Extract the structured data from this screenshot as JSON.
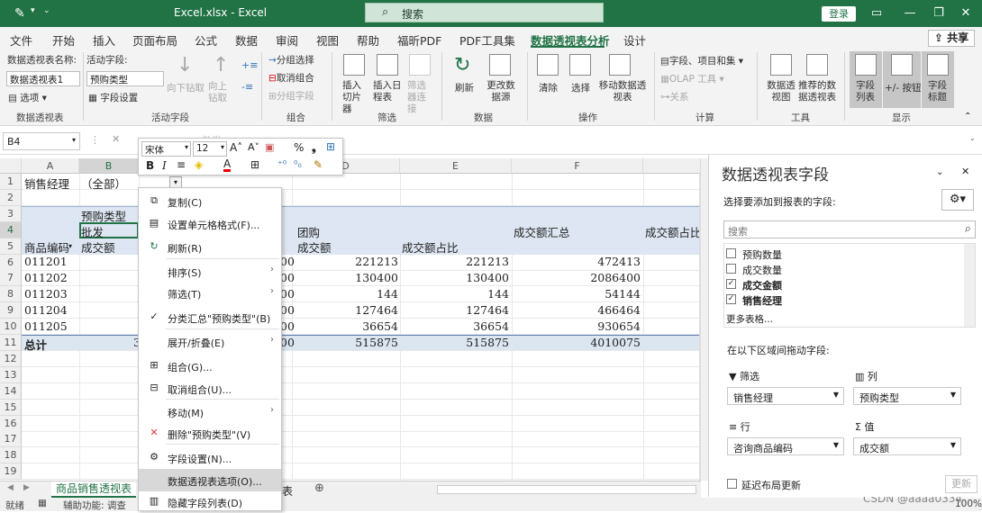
{
  "titlebar": {
    "title": "Excel.xlsx  -  Excel",
    "search": "搜索",
    "login": "登录",
    "min": "—",
    "restore": "❐",
    "close": "✕"
  },
  "tabs": [
    "文件",
    "开始",
    "插入",
    "页面布局",
    "公式",
    "数据",
    "审阅",
    "视图",
    "帮助",
    "福昕PDF",
    "PDF工具集",
    "数据透视表分析",
    "设计"
  ],
  "share": "共享",
  "ribbon": {
    "pt_name_label": "数据透视表名称:",
    "pt_name_value": "数据透视表1",
    "options": "选项",
    "group_pt": "数据透视表",
    "active_field_label": "活动字段:",
    "active_field_value": "预购类型",
    "field_settings": "字段设置",
    "drill_down": "向下钻取",
    "drill_up": "向上钻取",
    "group_active": "活动字段",
    "group_select": "分组选择",
    "ungroup": "取消组合",
    "group_field": "分组字段",
    "group_group": "组合",
    "insert_slicer": "插入切片器",
    "insert_timeline": "插入日程表",
    "filter_conn": "筛选器连接",
    "group_filter": "筛选",
    "refresh": "刷新",
    "change_source": "更改数据源",
    "group_data": "数据",
    "clear": "清除",
    "select": "选择",
    "move_pt": "移动数据透视表",
    "group_action": "操作",
    "fields_items": "字段、项目和集",
    "olap": "OLAP 工具",
    "relations": "关系",
    "group_calc": "计算",
    "pivot_chart": "数据透视图",
    "recommend": "推荐的数据透视表",
    "group_tools": "工具",
    "field_list": "字段列表",
    "pm_buttons": "+/- 按钮",
    "field_headers": "字段标题",
    "group_show": "显示"
  },
  "formula": {
    "namebox": "B4",
    "cancel": "✕",
    "value": "批发"
  },
  "grid": {
    "cols": [
      "A",
      "B",
      "C",
      "D",
      "E",
      "F"
    ],
    "rows": [
      "1",
      "2",
      "3",
      "4",
      "5",
      "6",
      "7",
      "8",
      "9",
      "10",
      "11",
      "12",
      "13",
      "14",
      "15",
      "16",
      "17",
      "18",
      "19"
    ],
    "a1": "销售经理",
    "b1": "（全部）",
    "b3": "预购类型",
    "b4": "批发",
    "a5": "商品编码",
    "b5": "成交额",
    "d4": "团购",
    "d5": "成交额",
    "e5": "成交额占比",
    "f4": "成交额汇总",
    "g4": "成交额占比",
    "rows_data": [
      {
        "code": "011201",
        "d": "00",
        "e1": "221213",
        "e2": "221213",
        "f": "472413"
      },
      {
        "code": "011202",
        "d": "00",
        "e1": "130400",
        "e2": "130400",
        "f": "2086400"
      },
      {
        "code": "011203",
        "d": "00",
        "e1": "144",
        "e2": "144",
        "f": "54144"
      },
      {
        "code": "011204",
        "d": "00",
        "e1": "127464",
        "e2": "127464",
        "f": "466464"
      },
      {
        "code": "011205",
        "d": "00",
        "e1": "36654",
        "e2": "36654",
        "f": "930654"
      }
    ],
    "total": {
      "label": "总计",
      "b": "3",
      "d": "00",
      "e1": "515875",
      "e2": "515875",
      "f": "4010075"
    }
  },
  "sheettabs": {
    "active": "商品销售透视表",
    "other": "表"
  },
  "status": {
    "ready": "就绪",
    "accessibility": "辅助功能: 调查",
    "zoom": "100%",
    "watermark": "CSDN @aaaa0334"
  },
  "mini_toolbar": {
    "font": "宋体",
    "size": "12"
  },
  "context_menu": [
    {
      "label": "复制(C)",
      "icon": "copy-icon",
      "glyph": "⧉"
    },
    {
      "label": "设置单元格格式(F)...",
      "icon": "format-cells-icon",
      "glyph": "▤"
    },
    {
      "label": "刷新(R)",
      "icon": "refresh-icon",
      "glyph": "↻"
    },
    {
      "label": "排序(S)",
      "icon": "",
      "glyph": ""
    },
    {
      "label": "筛选(T)",
      "icon": "",
      "glyph": ""
    },
    {
      "label": "分类汇总\"预购类型\"(B)",
      "icon": "check-icon",
      "glyph": "✓"
    },
    {
      "label": "展开/折叠(E)",
      "icon": "",
      "glyph": ""
    },
    {
      "label": "组合(G)...",
      "icon": "group-icon",
      "glyph": "⊞"
    },
    {
      "label": "取消组合(U)...",
      "icon": "ungroup-icon",
      "glyph": "⊟"
    },
    {
      "label": "移动(M)",
      "icon": "",
      "glyph": ""
    },
    {
      "label": "删除\"预购类型\"(V)",
      "icon": "delete-icon",
      "glyph": "✕"
    },
    {
      "label": "字段设置(N)...",
      "icon": "field-settings-icon",
      "glyph": "⚙"
    },
    {
      "label": "数据透视表选项(O)...",
      "icon": "",
      "glyph": ""
    },
    {
      "label": "隐藏字段列表(D)",
      "icon": "hide-field-list-icon",
      "glyph": "▥"
    }
  ],
  "pane": {
    "title": "数据透视表字段",
    "choose": "选择要添加到报表的字段:",
    "search": "搜索",
    "fields": [
      {
        "label": "预购数量",
        "checked": false
      },
      {
        "label": "成交数量",
        "checked": false
      },
      {
        "label": "成交金额",
        "checked": true
      },
      {
        "label": "销售经理",
        "checked": true
      }
    ],
    "more": "更多表格...",
    "drag": "在以下区域间拖动字段:",
    "filter_title": "筛选",
    "column_title": "列",
    "row_title": "行",
    "value_title": "值",
    "filter_value": "销售经理",
    "column_value": "预购类型",
    "row_value": "咨询商品编码",
    "value_value": "成交额",
    "defer": "延迟布局更新",
    "update": "更新"
  }
}
